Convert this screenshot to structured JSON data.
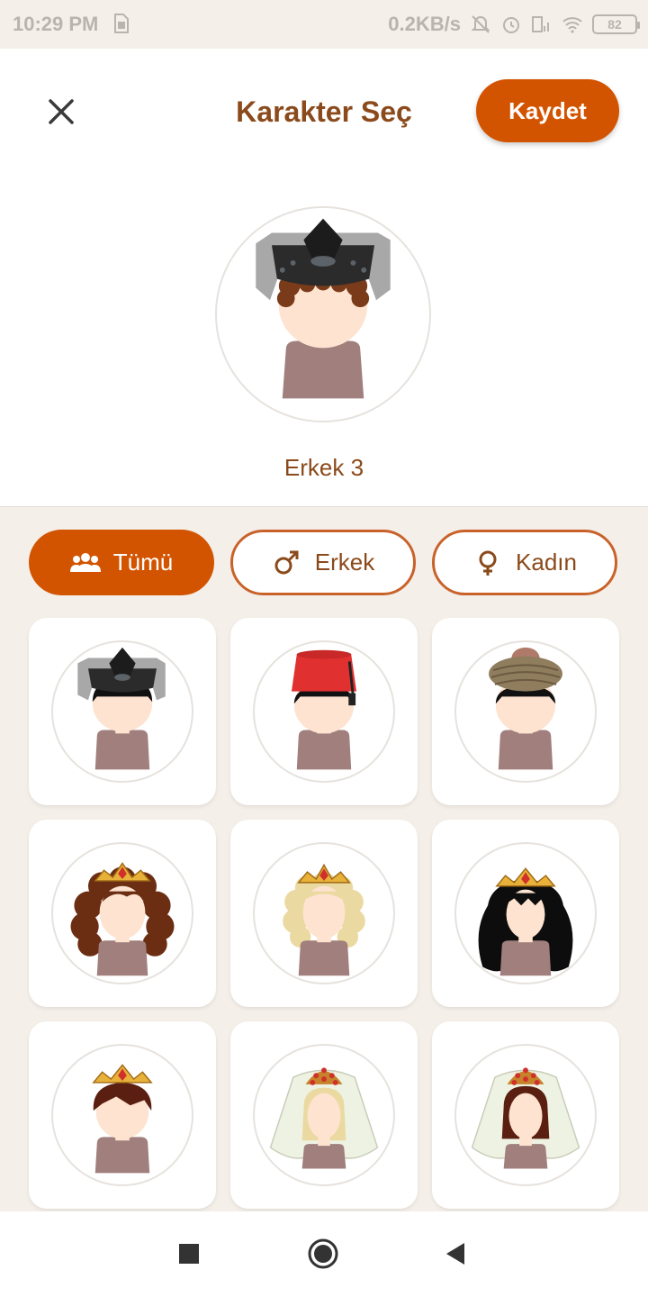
{
  "status_bar": {
    "time": "10:29 PM",
    "network_speed": "0.2KB/s",
    "battery_level": "82"
  },
  "header": {
    "title": "Karakter Seç",
    "save_label": "Kaydet",
    "close_icon": "close-icon"
  },
  "preview": {
    "selected_name": "Erkek 3"
  },
  "filters": [
    {
      "label": "Tümü",
      "icon": "group-icon",
      "active": true
    },
    {
      "label": "Erkek",
      "icon": "male-icon",
      "active": false
    },
    {
      "label": "Kadın",
      "icon": "female-icon",
      "active": false
    }
  ],
  "characters": [
    {
      "hat": "ottoman-helmet",
      "hair": "dark"
    },
    {
      "hat": "fez",
      "hair": "dark"
    },
    {
      "hat": "turban",
      "hair": "dark"
    },
    {
      "hat": "tiara",
      "hair": "brown-curly"
    },
    {
      "hat": "tiara",
      "hair": "blonde"
    },
    {
      "hat": "tiara",
      "hair": "black-long"
    },
    {
      "hat": "tiara",
      "hair": "short-brown"
    },
    {
      "hat": "veil",
      "hair": "blonde"
    },
    {
      "hat": "veil",
      "hair": "brown"
    }
  ],
  "colors": {
    "accent": "#d35400",
    "title": "#8b4a1b",
    "background": "#f4efe8",
    "skin": "#fde3d0",
    "body": "#a07f7c"
  },
  "nav": [
    "recent-apps-icon",
    "home-icon",
    "back-icon"
  ]
}
